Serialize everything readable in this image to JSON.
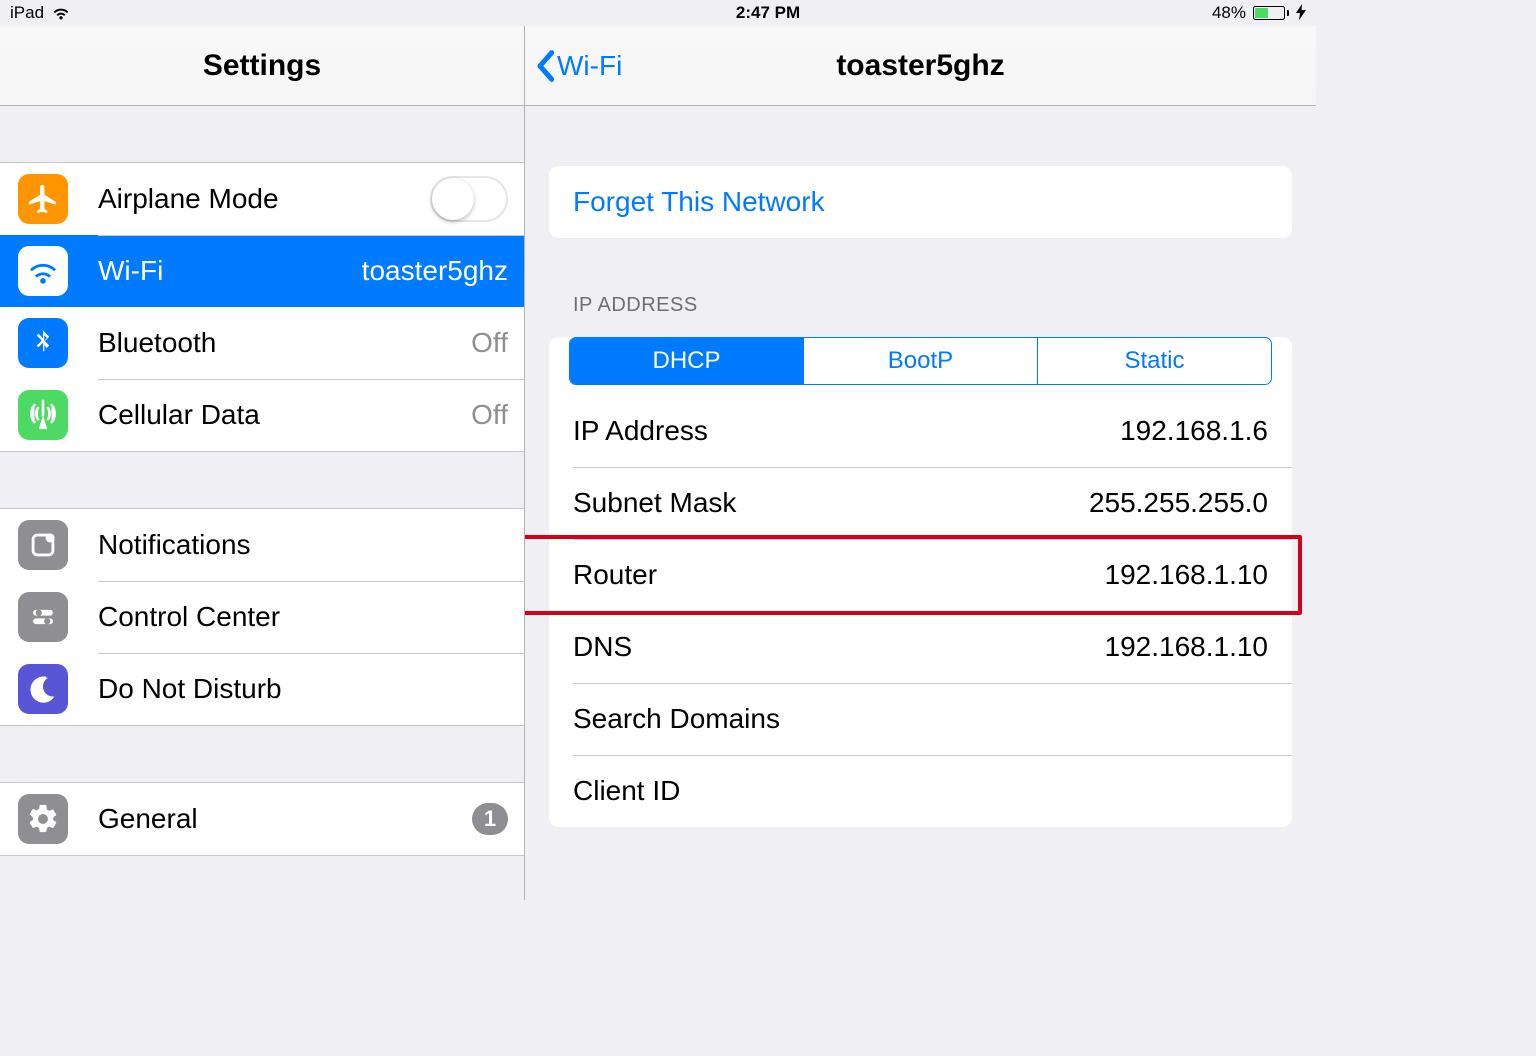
{
  "status": {
    "device": "iPad",
    "time": "2:47 PM",
    "battery_pct": "48%",
    "battery_fill_pct": 48
  },
  "sidebar": {
    "title": "Settings",
    "groups": [
      {
        "rows": [
          {
            "id": "airplane",
            "label": "Airplane Mode",
            "kind": "toggle",
            "value": null
          },
          {
            "id": "wifi",
            "label": "Wi-Fi",
            "kind": "nav",
            "value": "toaster5ghz",
            "selected": true
          },
          {
            "id": "bluetooth",
            "label": "Bluetooth",
            "kind": "nav",
            "value": "Off"
          },
          {
            "id": "cellular",
            "label": "Cellular Data",
            "kind": "nav",
            "value": "Off"
          }
        ]
      },
      {
        "rows": [
          {
            "id": "notifications",
            "label": "Notifications",
            "kind": "nav"
          },
          {
            "id": "controlcenter",
            "label": "Control Center",
            "kind": "nav"
          },
          {
            "id": "dnd",
            "label": "Do Not Disturb",
            "kind": "nav"
          }
        ]
      },
      {
        "rows": [
          {
            "id": "general",
            "label": "General",
            "kind": "nav",
            "badge": "1"
          }
        ]
      }
    ]
  },
  "detail": {
    "back_label": "Wi-Fi",
    "title": "toaster5ghz",
    "forget": "Forget This Network",
    "section_ip": "IP ADDRESS",
    "segments": [
      "DHCP",
      "BootP",
      "Static"
    ],
    "segment_active_index": 0,
    "rows": [
      {
        "k": "IP Address",
        "v": "192.168.1.6"
      },
      {
        "k": "Subnet Mask",
        "v": "255.255.255.0"
      },
      {
        "k": "Router",
        "v": "192.168.1.10",
        "highlighted": true
      },
      {
        "k": "DNS",
        "v": "192.168.1.10"
      },
      {
        "k": "Search Domains",
        "v": ""
      },
      {
        "k": "Client ID",
        "v": ""
      }
    ]
  },
  "colors": {
    "accent": "#007aff",
    "highlight": "#d0021b"
  }
}
